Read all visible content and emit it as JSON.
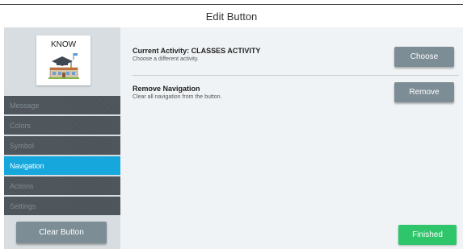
{
  "header": {
    "title": "Edit Button"
  },
  "preview": {
    "label": "KNOW",
    "symbol_icon": "graduation-cap-school-icon"
  },
  "sidebar": {
    "items": [
      {
        "label": "Message"
      },
      {
        "label": "Colors"
      },
      {
        "label": "Symbol"
      },
      {
        "label": "Navigation",
        "active": true
      },
      {
        "label": "Actions"
      },
      {
        "label": "Settings"
      }
    ],
    "clear_label": "Clear Button"
  },
  "main": {
    "activity": {
      "title": "Current Activity: CLASSES ACTIVITY",
      "desc": "Choose a different activity.",
      "button": "Choose"
    },
    "remove": {
      "title": "Remove Navigation",
      "desc": "Clear all navigation from the button.",
      "button": "Remove"
    },
    "finished": "Finished"
  },
  "colors": {
    "accent": "#16a7dc",
    "finished": "#2fc56a",
    "button": "#7d8d96",
    "nav_bg": "#4d5459"
  }
}
